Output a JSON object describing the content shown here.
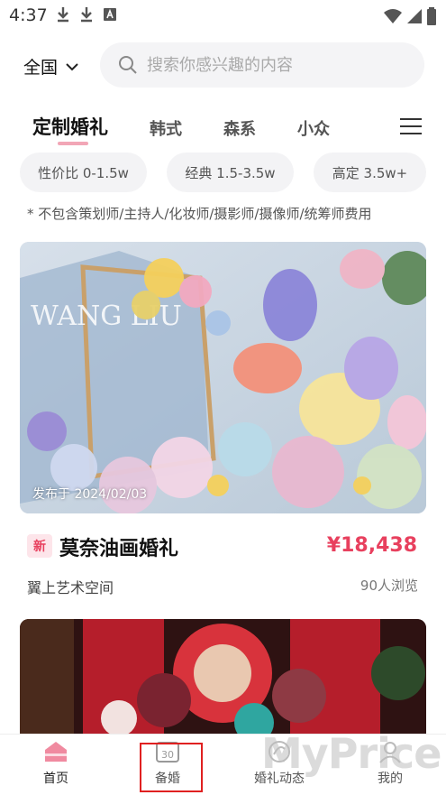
{
  "status_bar": {
    "time": "4:37"
  },
  "header": {
    "city": "全国",
    "search_placeholder": "搜索你感兴趣的内容"
  },
  "tabs": [
    {
      "label": "定制婚礼",
      "active": true
    },
    {
      "label": "韩式",
      "active": false
    },
    {
      "label": "森系",
      "active": false
    },
    {
      "label": "小众",
      "active": false
    }
  ],
  "price_filters": [
    {
      "label": "性价比 0-1.5w"
    },
    {
      "label": "经典 1.5-3.5w"
    },
    {
      "label": "高定 3.5w+"
    }
  ],
  "note": "* 不包含策划师/主持人/化妆师/摄影师/摄像师/统筹师费用",
  "cards": [
    {
      "posted": "发布于 2024/02/03",
      "badge": "新",
      "title": "莫奈油画婚礼",
      "price": "¥18,438",
      "venue": "翼上艺术空间",
      "views": "90人浏览",
      "image_text": "WANG LIU"
    }
  ],
  "bottom_nav": [
    {
      "label": "首页",
      "icon": "home-icon",
      "active": true
    },
    {
      "label": "备婚",
      "icon": "calendar-30-icon",
      "active": false
    },
    {
      "label": "婚礼动态",
      "icon": "dynamic-icon",
      "active": false
    },
    {
      "label": "我的",
      "icon": "profile-icon",
      "active": false
    }
  ],
  "watermark": "MyPrice",
  "colors": {
    "accent": "#e8405e",
    "badge_bg": "#fde5ea",
    "chip_bg": "#f3f3f5",
    "highlight": "#e02020"
  }
}
